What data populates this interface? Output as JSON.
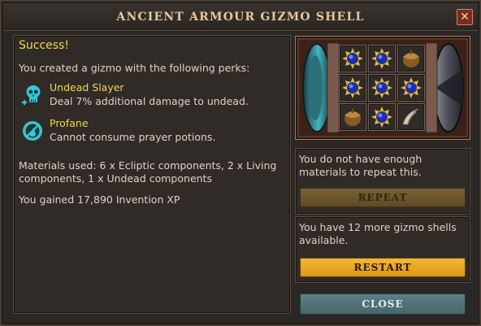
{
  "window": {
    "title": "ANCIENT ARMOUR GIZMO SHELL",
    "close_glyph": "✕"
  },
  "result": {
    "status": "Success!",
    "created_text": "You created a gizmo with the following perks:",
    "perks": [
      {
        "name": "Undead Slayer",
        "description": "Deal 7% additional damage to undead.",
        "icon": "skull-icon"
      },
      {
        "name": "Profane",
        "description": "Cannot consume prayer potions.",
        "icon": "no-prayer-icon"
      }
    ],
    "materials_text": "Materials used: 6 x Ecliptic components, 2 x Living components, 1 x Undead components",
    "xp_text": "You gained 17,890 Invention XP"
  },
  "gizmo": {
    "slots": [
      "ecliptic-component-icon",
      "ecliptic-component-icon",
      "living-component-icon",
      "ecliptic-component-icon",
      "ecliptic-component-icon",
      "ecliptic-component-icon",
      "living-component-icon",
      "ecliptic-component-icon",
      "undead-component-icon"
    ]
  },
  "repeat_panel": {
    "text": "You do not have enough materials to repeat this.",
    "button_label": "REPEAT"
  },
  "restart_panel": {
    "text": "You have 12 more gizmo shells available.",
    "button_label": "RESTART"
  },
  "close_button_label": "CLOSE",
  "colors": {
    "accent_yellow": "#f1d84a",
    "restart_orange": "#e7a523",
    "frame_copper": "#b07a5a"
  }
}
